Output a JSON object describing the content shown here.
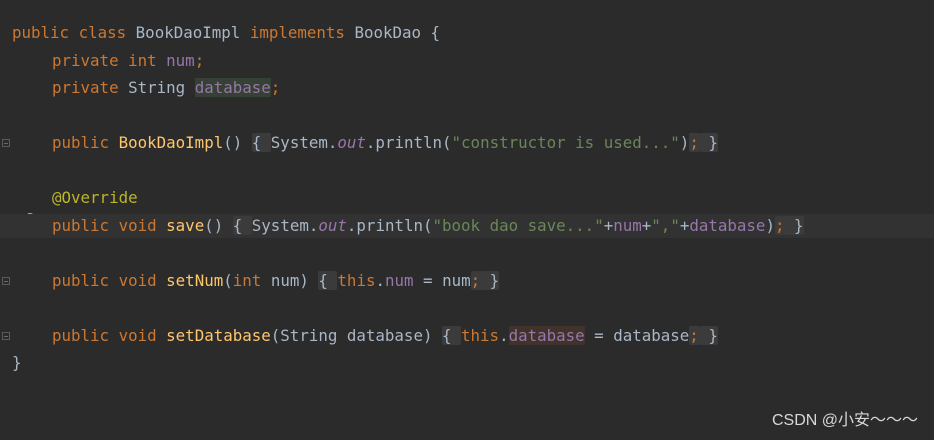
{
  "code": {
    "l1": {
      "kw_public": "public",
      "kw_class": "class",
      "class_name": "BookDaoImpl",
      "kw_implements": "implements",
      "iface": "BookDao",
      "brace": "{"
    },
    "l2": {
      "kw_private": "private",
      "kw_int": "int",
      "field": "num",
      "semi": ";"
    },
    "l3": {
      "kw_private": "private",
      "type": "String",
      "field": "database",
      "semi": ";"
    },
    "l4": {
      "kw_public": "public",
      "ctor": "BookDaoImpl",
      "parens": "()",
      "open": "{",
      "system": "System.",
      "out": "out",
      "println": ".println(",
      "str": "\"constructor is used...\"",
      "close_paren": ")",
      "semi": ";",
      "close": "}"
    },
    "l5": {
      "annotation": "@Override"
    },
    "l6": {
      "kw_public": "public",
      "kw_void": "void",
      "method": "save",
      "parens": "()",
      "open": "{",
      "system": "System.",
      "out": "out",
      "println": ".println(",
      "str1": "\"book dao save...\"",
      "plus1": "+",
      "field_num": "num",
      "plus2": "+",
      "str2": "\",\"",
      "plus3": "+",
      "field_db": "database",
      "close_paren": ")",
      "semi": ";",
      "close": "}"
    },
    "l7": {
      "kw_public": "public",
      "kw_void": "void",
      "method": "setNum",
      "paren_open": "(",
      "kw_int": "int",
      "param": "num",
      "paren_close": ")",
      "open": "{",
      "kw_this": "this",
      "dot": ".",
      "field": "num",
      "assign": " = num",
      "semi": ";",
      "close": "}"
    },
    "l8": {
      "kw_public": "public",
      "kw_void": "void",
      "method": "setDatabase",
      "params": "(String database)",
      "open": "{",
      "kw_this": "this",
      "dot": ".",
      "field": "database",
      "assign": " = database",
      "semi": ";",
      "close": "}"
    },
    "l9": {
      "brace": "}"
    }
  },
  "watermark": "CSDN @小安～～～",
  "icons": {
    "intention": "lightbulb-icon",
    "fold": "fold-marker-icon"
  },
  "colors": {
    "background": "#2b2b2b",
    "keyword": "#cc7832",
    "method": "#ffc66d",
    "string": "#6a8759",
    "field": "#9876aa",
    "annotation": "#bbb529",
    "default_text": "#a9b7c6"
  }
}
